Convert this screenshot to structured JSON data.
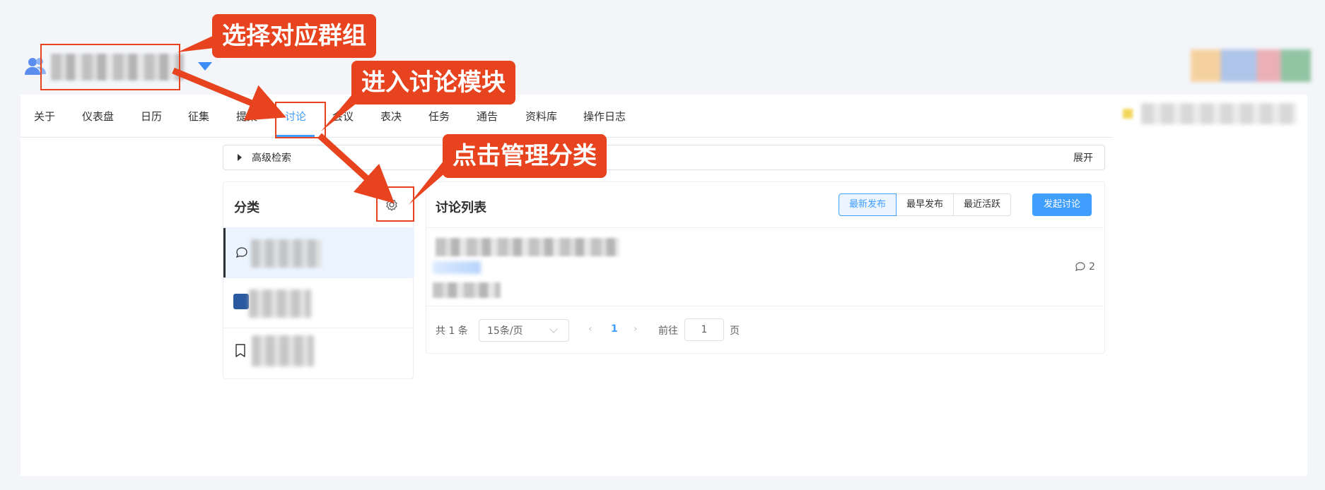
{
  "header": {
    "group_caret": "▼"
  },
  "tabs": [
    {
      "label": "关于",
      "active": false
    },
    {
      "label": "仪表盘",
      "active": false
    },
    {
      "label": "日历",
      "active": false
    },
    {
      "label": "征集",
      "active": false
    },
    {
      "label": "提案",
      "active": false
    },
    {
      "label": "讨论",
      "active": true
    },
    {
      "label": "会议",
      "active": false
    },
    {
      "label": "表决",
      "active": false
    },
    {
      "label": "任务",
      "active": false
    },
    {
      "label": "通告",
      "active": false
    },
    {
      "label": "资料库",
      "active": false
    },
    {
      "label": "操作日志",
      "active": false
    }
  ],
  "advanced_search": {
    "label": "高级检索",
    "expand_label": "展开"
  },
  "categories": {
    "title": "分类",
    "settings_icon": "gear-icon"
  },
  "discussions": {
    "title": "讨论列表",
    "sort_options": [
      "最新发布",
      "最早发布",
      "最近活跃"
    ],
    "sort_selected": "最新发布",
    "start_button": "发起讨论",
    "items": [
      {
        "comment_count": "2"
      }
    ]
  },
  "pagination": {
    "total": "共 1 条",
    "page_size": "15条/页",
    "prev": "‹",
    "current_page": "1",
    "next": "›",
    "goto_label": "前往",
    "goto_value": "1",
    "page_suffix": "页"
  },
  "annotations": {
    "step1": "选择对应群组",
    "step2": "进入讨论模块",
    "step3": "点击管理分类"
  },
  "colors": {
    "accent": "#409eff",
    "annotation": "#e8431f"
  }
}
